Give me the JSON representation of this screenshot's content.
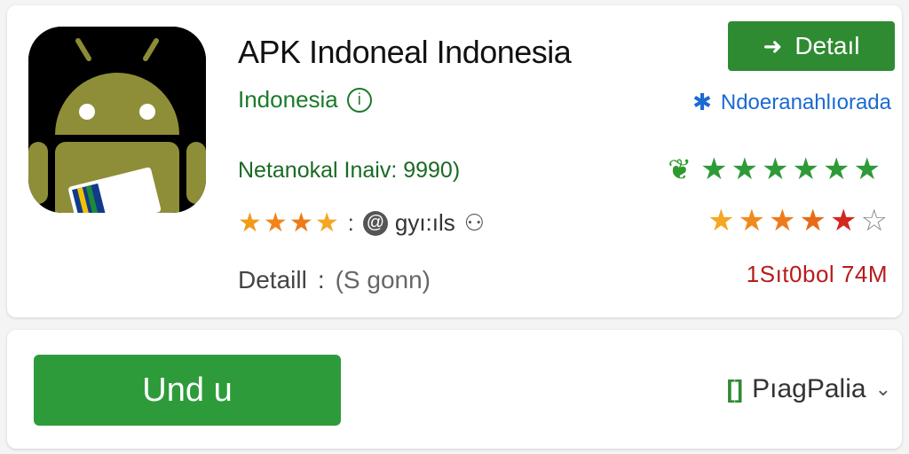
{
  "app": {
    "title": "APK Indoneal Indonesia",
    "developer": "Indonesia",
    "developer_badge": "i",
    "version_line": "Netanokal Inaiv: 9990)",
    "rating": {
      "stars_filled": 4,
      "separator": ":",
      "review_text": "gyı:ıls",
      "star_color": "#f29a1a"
    },
    "detail": {
      "label": "Detaill",
      "separator": ":",
      "value": "(S gonn)"
    }
  },
  "actions": {
    "detail_button_label": "Detaıl",
    "source_link_label": "Ndoeranahlıorada",
    "size_text": "1Sıt0bol 74M",
    "primary_button_label": "Und u",
    "platform_label": "PıagPalia"
  },
  "green_stars": {
    "count": 6,
    "color": "#2e9a38"
  },
  "color_stars": {
    "colors": [
      "#f5a623",
      "#f08a1d",
      "#ee7b1a",
      "#e96a16",
      "#d2281e"
    ],
    "empty_star_color": "#888888"
  },
  "colors": {
    "accent_green": "#2e9b3a",
    "link_blue": "#1b6ad1",
    "size_red": "#b71c1c"
  }
}
